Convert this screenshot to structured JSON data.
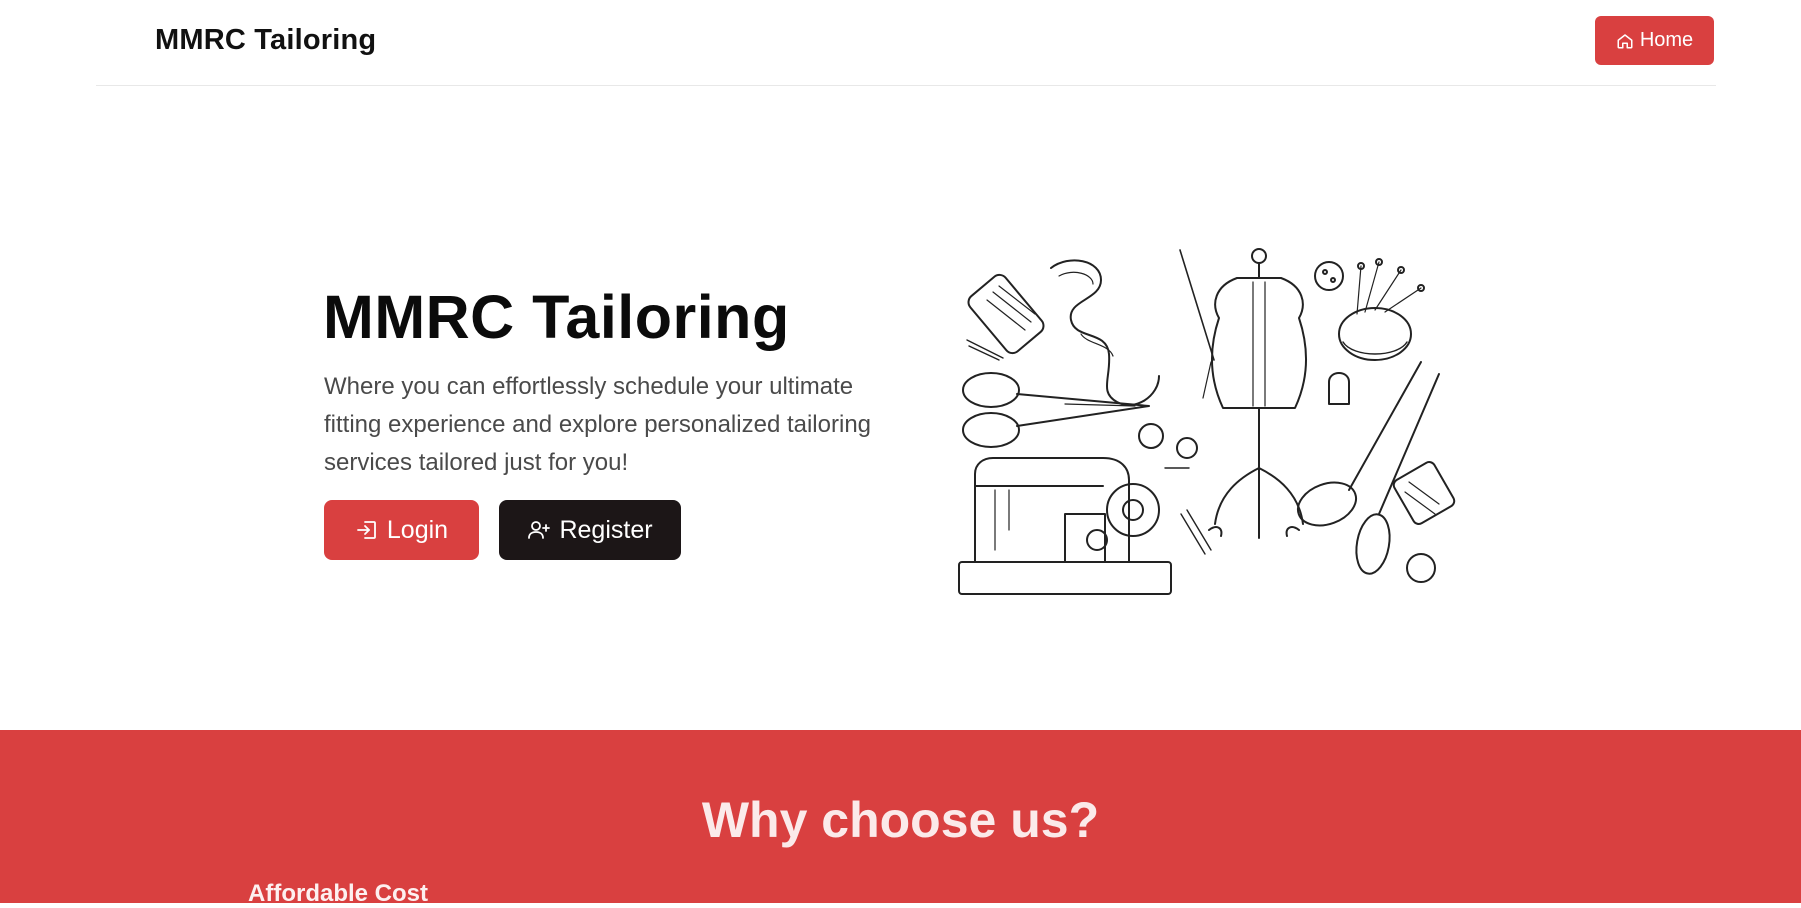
{
  "navbar": {
    "brand": "MMRC Tailoring",
    "home_label": "Home"
  },
  "hero": {
    "title": "MMRC Tailoring",
    "description": "Where you can effortlessly schedule your ultimate fitting experience and explore personalized tailoring services tailored just for you!",
    "login_label": "Login",
    "register_label": "Register",
    "illustration_icon": "tailoring-tools-illustration"
  },
  "why": {
    "title": "Why choose us?",
    "first_item": "Affordable Cost"
  },
  "colors": {
    "accent": "#d94040",
    "dark": "#1c1617",
    "text": "#111111",
    "muted": "#4a4a4a"
  }
}
